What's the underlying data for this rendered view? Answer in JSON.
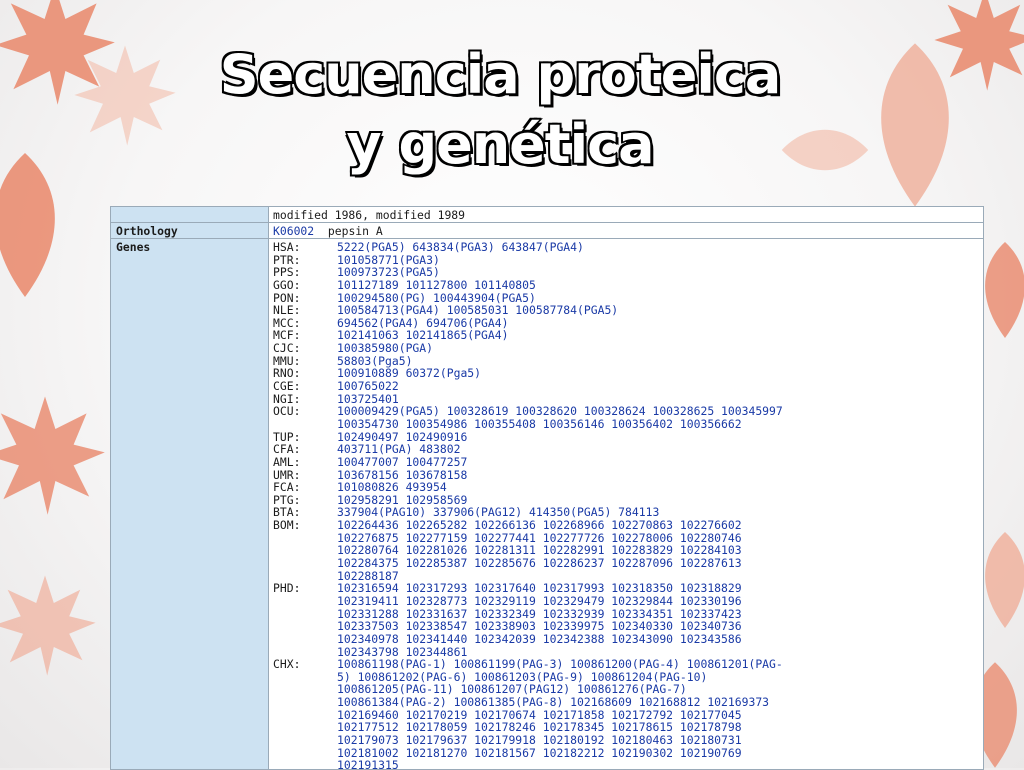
{
  "slide": {
    "title_line1": "Secuencia proteica",
    "title_line2": "y genética"
  },
  "entry": {
    "top_value": "modified 1986, modified 1989",
    "orthology_label": "Orthology",
    "orthology_id": "K06002",
    "orthology_name": "pepsin A",
    "genes_label": "Genes",
    "genes": [
      {
        "org": "HSA:",
        "ids": "5222(PGA5) 643834(PGA3) 643847(PGA4)"
      },
      {
        "org": "PTR:",
        "ids": "101058771(PGA3)"
      },
      {
        "org": "PPS:",
        "ids": "100973723(PGA5)"
      },
      {
        "org": "GGO:",
        "ids": "101127189 101127800 101140805"
      },
      {
        "org": "PON:",
        "ids": "100294580(PG) 100443904(PGA5)"
      },
      {
        "org": "NLE:",
        "ids": "100584713(PGA4) 100585031 100587784(PGA5)"
      },
      {
        "org": "MCC:",
        "ids": "694562(PGA4) 694706(PGA4)"
      },
      {
        "org": "MCF:",
        "ids": "102141063 102141865(PGA4)"
      },
      {
        "org": "CJC:",
        "ids": "100385980(PGA)"
      },
      {
        "org": "MMU:",
        "ids": "58803(Pga5)"
      },
      {
        "org": "RNO:",
        "ids": "100910889 60372(Pga5)"
      },
      {
        "org": "CGE:",
        "ids": "100765022"
      },
      {
        "org": "NGI:",
        "ids": "103725401"
      },
      {
        "org": "OCU:",
        "ids": "100009429(PGA5) 100328619 100328620 100328624 100328625 100345997"
      },
      {
        "org": "",
        "ids": "100354730 100354986 100355408 100356146 100356402 100356662"
      },
      {
        "org": "TUP:",
        "ids": "102490497 102490916"
      },
      {
        "org": "CFA:",
        "ids": "403711(PGA) 483802"
      },
      {
        "org": "AML:",
        "ids": "100477007 100477257"
      },
      {
        "org": "UMR:",
        "ids": "103678156 103678158"
      },
      {
        "org": "FCA:",
        "ids": "101080826 493954"
      },
      {
        "org": "PTG:",
        "ids": "102958291 102958569"
      },
      {
        "org": "BTA:",
        "ids": "337904(PAG10) 337906(PAG12) 414350(PGA5) 784113"
      },
      {
        "org": "BOM:",
        "ids": "102264436 102265282 102266136 102268966 102270863 102276602"
      },
      {
        "org": "",
        "ids": "102276875 102277159 102277441 102277726 102278006 102280746"
      },
      {
        "org": "",
        "ids": "102280764 102281026 102281311 102282991 102283829 102284103"
      },
      {
        "org": "",
        "ids": "102284375 102285387 102285676 102286237 102287096 102287613"
      },
      {
        "org": "",
        "ids": "102288187"
      },
      {
        "org": "PHD:",
        "ids": "102316594 102317293 102317640 102317993 102318350 102318829"
      },
      {
        "org": "",
        "ids": "102319411 102328773 102329119 102329479 102329844 102330196"
      },
      {
        "org": "",
        "ids": "102331288 102331637 102332349 102332939 102334351 102337423"
      },
      {
        "org": "",
        "ids": "102337503 102338547 102338903 102339975 102340330 102340736"
      },
      {
        "org": "",
        "ids": "102340978 102341440 102342039 102342388 102343090 102343586"
      },
      {
        "org": "",
        "ids": "102343798 102344861"
      },
      {
        "org": "CHX:",
        "ids": "100861198(PAG-1) 100861199(PAG-3) 100861200(PAG-4) 100861201(PAG-"
      },
      {
        "org": "",
        "ids": "5) 100861202(PAG-6) 100861203(PAG-9) 100861204(PAG-10)"
      },
      {
        "org": "",
        "ids": "100861205(PAG-11) 100861207(PAG12) 100861276(PAG-7)"
      },
      {
        "org": "",
        "ids": "100861384(PAG-2) 100861385(PAG-8) 102168609 102168812 102169373"
      },
      {
        "org": "",
        "ids": "102169460 102170219 102170674 102171858 102172792 102177045"
      },
      {
        "org": "",
        "ids": "102177512 102178059 102178246 102178345 102178615 102178798"
      },
      {
        "org": "",
        "ids": "102179073 102179637 102179918 102180192 102180463 102180731"
      },
      {
        "org": "",
        "ids": "102181002 102181270 102181567 102182212 102190302 102190769"
      },
      {
        "org": "",
        "ids": "102191315"
      }
    ]
  },
  "colors": {
    "leaf": "#e9876a",
    "label_bg": "#cde2f2",
    "link": "#1a3aa6"
  },
  "icons": [
    "maple-leaf-icon"
  ]
}
